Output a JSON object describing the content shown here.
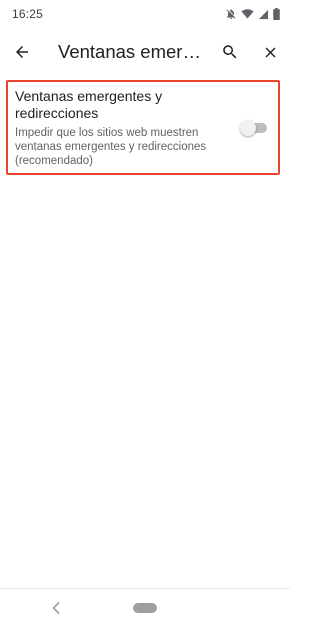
{
  "status_bar": {
    "time": "16:25",
    "icons": [
      "notifications-off-icon",
      "wifi-icon",
      "cellular-signal-icon",
      "battery-icon"
    ]
  },
  "app_bar": {
    "title": "Ventanas emergentes y redirecciones",
    "back_icon": "arrow-back-icon",
    "search_icon": "search-icon",
    "close_icon": "close-icon"
  },
  "setting": {
    "title": "Ventanas emergentes y redirecciones",
    "description": "Impedir que los sitios web muestren ventanas emergentes y redirecciones (recomendado)",
    "toggle_on": false,
    "highlight_color": "#e8432b"
  },
  "nav_bar": {
    "back_icon": "nav-back-icon",
    "home_icon": "home-pill-icon"
  }
}
